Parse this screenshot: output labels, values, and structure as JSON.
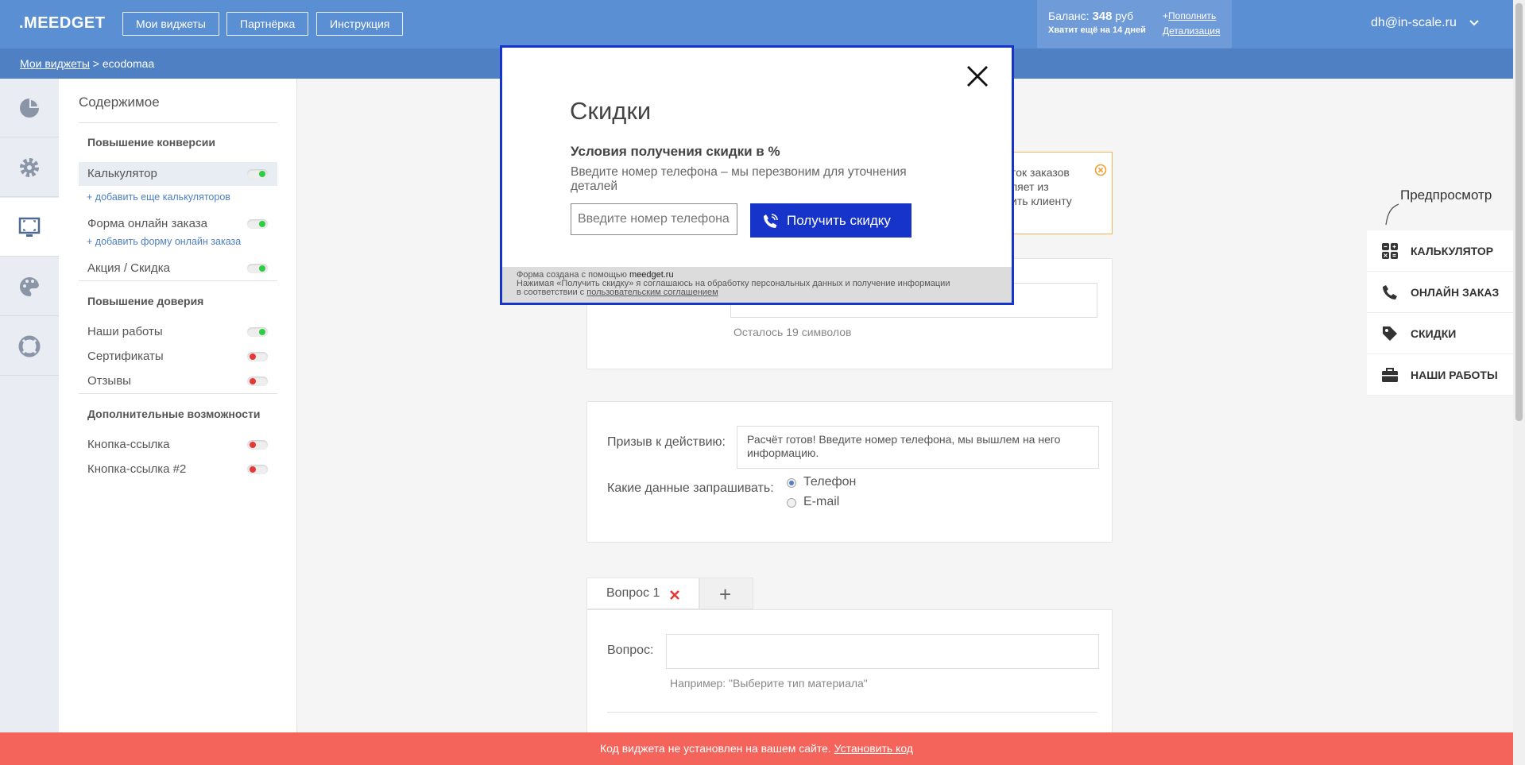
{
  "header": {
    "logo": ".MEEDGET",
    "nav": [
      "Мои виджеты",
      "Партнёрка",
      "Инструкция"
    ],
    "balance_label": "Баланс: ",
    "balance_value": "348",
    "balance_currency": " руб",
    "days_left": "Хватит ещё на 14 дней",
    "topup_prefix": "+",
    "topup_link": "Пополнить",
    "details_link": "Детализация",
    "user_email": "dh@in-scale.ru"
  },
  "breadcrumb": {
    "root": "Мои виджеты",
    "sep": " > ",
    "current": "ecodomaa"
  },
  "menu": {
    "title": "Содержимое",
    "section1": "Повышение конверсии",
    "calculator": "Калькулятор",
    "add_calculators": "+ добавить еще калькуляторов",
    "order_form": "Форма онлайн заказа",
    "add_order_form": "+ добавить форму онлайн заказа",
    "discount": "Акция / Скидка",
    "section2": "Повышение доверия",
    "our_works": "Наши работы",
    "certificates": "Сертификаты",
    "reviews": "Отзывы",
    "section3": "Дополнительные возможности",
    "link_button": "Кнопка-ссылка",
    "link_button2": "Кнопка-ссылка #2"
  },
  "main": {
    "chars_left": "Осталось 19 символов",
    "cta_label": "Призыв к действию:",
    "cta_value": "Расчёт готов! Введите номер телефона, мы вышлем на него информацию.",
    "request_label": "Какие данные запрашивать:",
    "opt_phone": "Телефон",
    "opt_email": "E-mail",
    "tab1": "Вопрос 1",
    "tab_add": "+",
    "question_label": "Вопрос:",
    "question_hint": "Например: \"Выберите тип материала\"",
    "warn_line1": "ток заказов",
    "warn_line2": "ляет из",
    "warn_line3": "ить клиенту"
  },
  "preview": {
    "title": "Предпросмотр",
    "items": [
      "КАЛЬКУЛЯТОР",
      "ОНЛАЙН ЗАКАЗ",
      "СКИДКИ",
      "НАШИ РАБОТЫ"
    ]
  },
  "modal": {
    "title": "Скидки",
    "subtitle": "Условия получения скидки в %",
    "description": "Введите номер телефона – мы перезвоним для уточнения деталей",
    "phone_placeholder": "Введите номер телефона",
    "button": "Получить скидку",
    "footer_line1_prefix": "Форма создана с помощью ",
    "footer_brand": "meedget.ru",
    "footer_line2": "Нажимая «Получить скидку» я соглашаюсь на обработку персональных данных и получение информации",
    "footer_line3_prefix": "в соответствии с ",
    "footer_link": "пользовательским соглашением"
  },
  "banner": {
    "text": "Код виджета не установлен на вашем сайте. ",
    "link": "Установить код"
  },
  "colors": {
    "header": "#5b8fd3",
    "breadcrumb": "#4f80c3",
    "modal_accent": "#1634c9",
    "banner": "#f4645b"
  }
}
